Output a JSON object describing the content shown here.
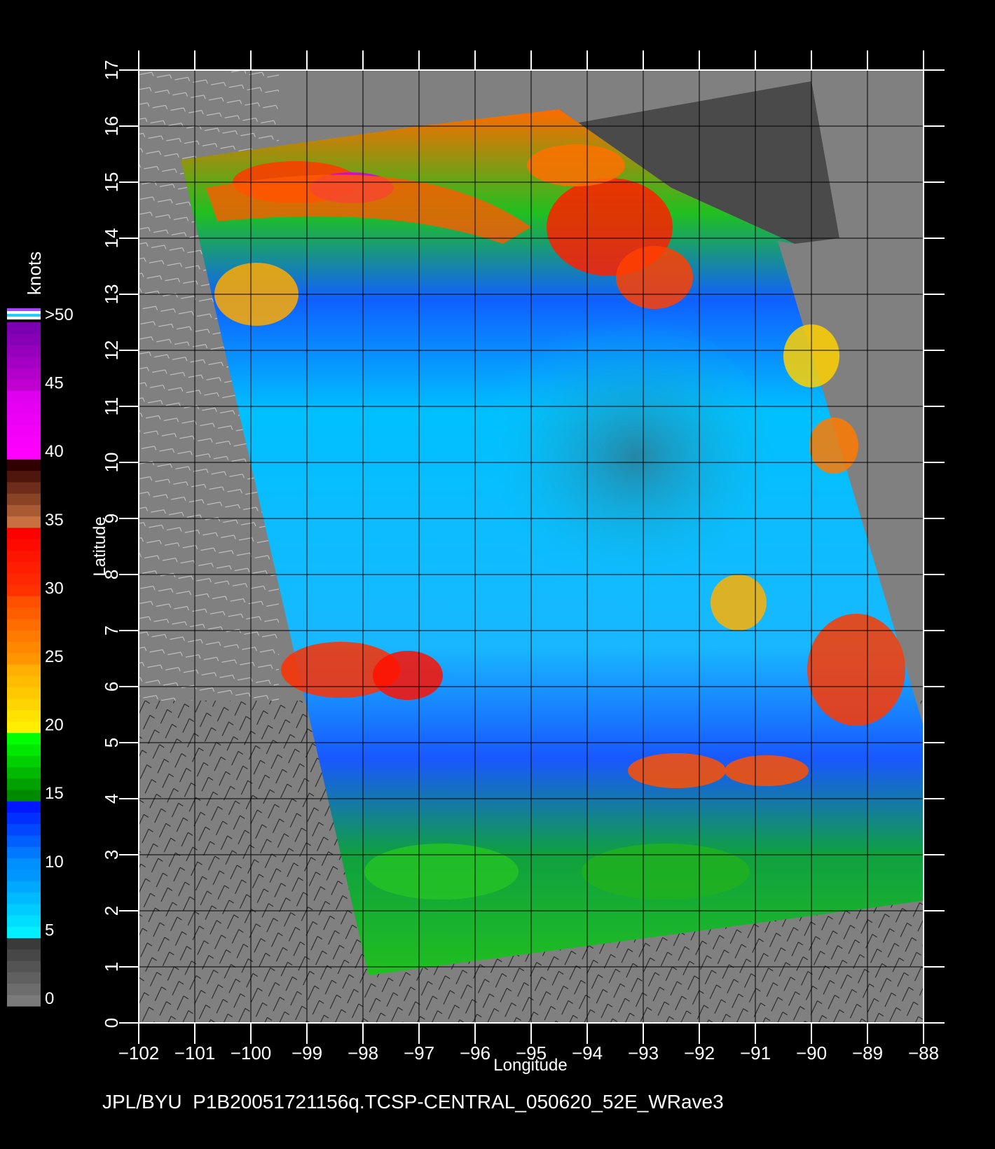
{
  "map": {
    "colorbar": {
      "title": "knots",
      "tick_labels": [
        ">50",
        "45",
        "40",
        "35",
        "30",
        "25",
        "20",
        "15",
        "10",
        "5",
        "0"
      ],
      "bands": [
        {
          "from": 0,
          "to": 5,
          "colors": [
            "#7a7a7a",
            "#3a3a3a"
          ]
        },
        {
          "from": 5,
          "to": 10,
          "colors": [
            "#00f0ff",
            "#0096ff"
          ]
        },
        {
          "from": 10,
          "to": 15,
          "colors": [
            "#0090ff",
            "#0018ff"
          ]
        },
        {
          "from": 15,
          "to": 20,
          "colors": [
            "#008a00",
            "#00ff00"
          ]
        },
        {
          "from": 20,
          "to": 25,
          "colors": [
            "#ffee00",
            "#ffb000"
          ]
        },
        {
          "from": 25,
          "to": 30,
          "colors": [
            "#ff9600",
            "#ff5000"
          ]
        },
        {
          "from": 30,
          "to": 35,
          "colors": [
            "#ff3200",
            "#ff0000"
          ]
        },
        {
          "from": 35,
          "to": 40,
          "colors": [
            "#c87040",
            "#300000"
          ]
        },
        {
          "from": 40,
          "to": 45,
          "colors": [
            "#ff00ff",
            "#e000f0"
          ]
        },
        {
          "from": 45,
          "to": 50,
          "colors": [
            "#c000d0",
            "#7a00b0"
          ]
        }
      ],
      "overflow_colors": [
        "#aa44ff",
        "#ffffff",
        "#22ccff",
        "#ffffff"
      ]
    },
    "xlabel": "Longitude",
    "ylabel": "Latitude",
    "x_ticks": [
      -102,
      -101,
      -100,
      -99,
      -98,
      -97,
      -96,
      -95,
      -94,
      -93,
      -92,
      -91,
      -90,
      -89,
      -88
    ],
    "y_ticks": [
      0,
      1,
      2,
      3,
      4,
      5,
      6,
      7,
      8,
      9,
      10,
      11,
      12,
      13,
      14,
      15,
      16,
      17
    ],
    "x_range": [
      -102,
      -88
    ],
    "y_range": [
      0,
      17
    ],
    "background_color": "#808080",
    "land_color": "#4a4a4a",
    "swath_corners_lonlat": [
      [
        -101.25,
        15.4
      ],
      [
        -97.0,
        16.0
      ],
      [
        -94.5,
        16.3
      ],
      [
        -92.5,
        14.9
      ],
      [
        -90.3,
        13.9
      ],
      [
        -90.6,
        13.95
      ],
      [
        -87.1,
        2.3
      ],
      [
        -97.9,
        0.85
      ]
    ],
    "footer": "JPL/BYU  P1B20051721156q.TCSP-CENTRAL_050620_52E_WRave3"
  }
}
